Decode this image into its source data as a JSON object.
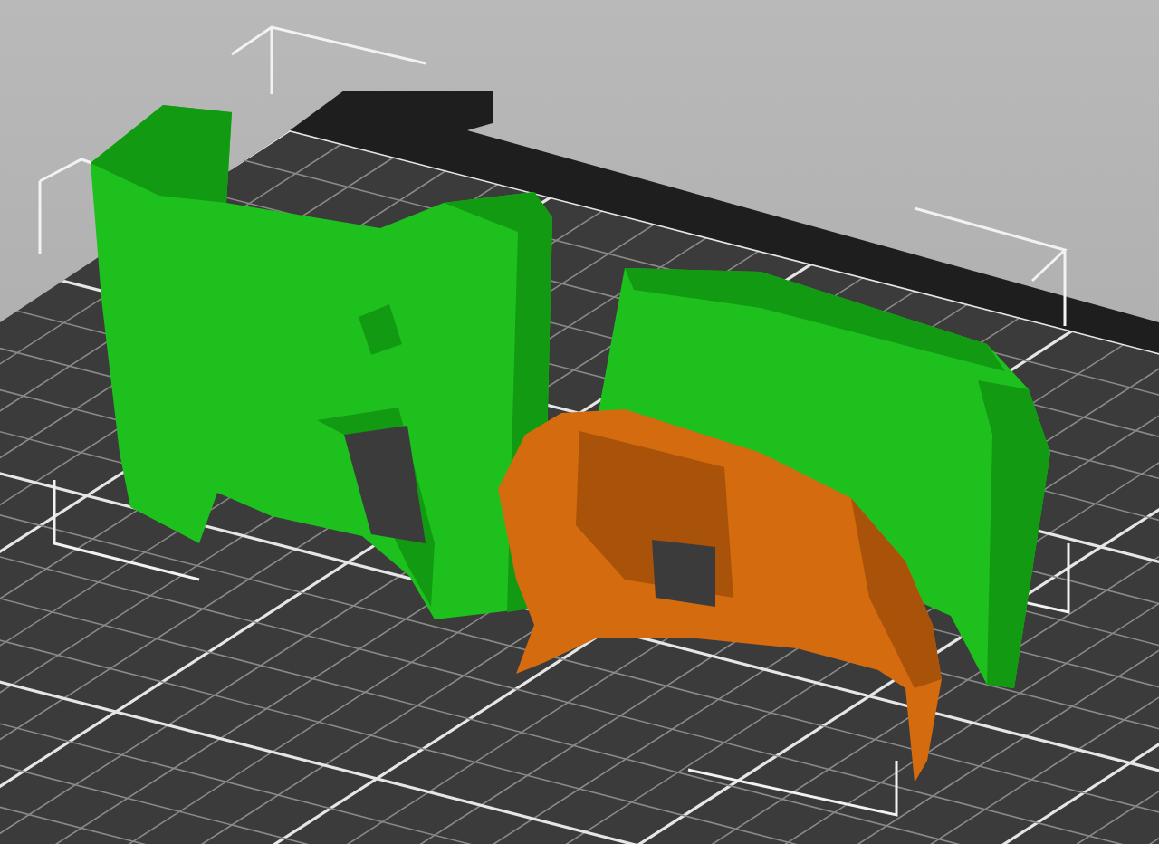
{
  "viewport": {
    "objects": [
      {
        "kind": "housing",
        "selected": false
      },
      {
        "kind": "shell",
        "selected": false
      },
      {
        "kind": "bezel",
        "selected": true
      }
    ]
  }
}
